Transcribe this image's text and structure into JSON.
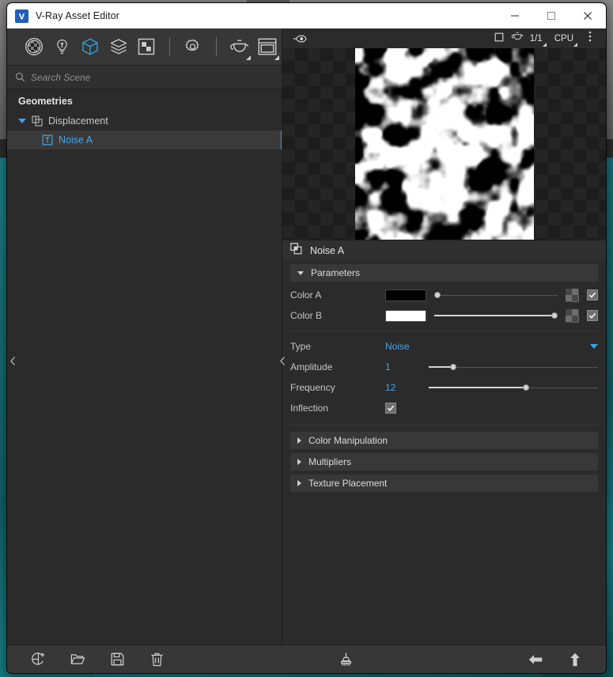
{
  "window": {
    "title": "V-Ray Asset Editor",
    "logo_icon": "vray-logo-icon",
    "minimize_label": "–",
    "maximize_label": "□",
    "close_label": "×"
  },
  "toolbar": {
    "items": [
      {
        "name": "materials-button",
        "icon": "checker-sphere-icon",
        "active": false,
        "dropdown": false
      },
      {
        "name": "lights-button",
        "icon": "light-bulb-icon",
        "active": false,
        "dropdown": false
      },
      {
        "name": "geometries-button",
        "icon": "cube-icon",
        "active": true,
        "dropdown": false
      },
      {
        "name": "render-elements-button",
        "icon": "layers-icon",
        "active": false,
        "dropdown": false
      },
      {
        "name": "textures-button",
        "icon": "texture-icon",
        "active": false,
        "dropdown": false
      },
      {
        "name": "settings-button",
        "icon": "gear-icon",
        "active": false,
        "dropdown": false
      },
      {
        "name": "render-button",
        "icon": "teapot-icon",
        "active": false,
        "dropdown": true
      },
      {
        "name": "frame-buffer-button",
        "icon": "render-window-icon",
        "active": false,
        "dropdown": true
      }
    ]
  },
  "search": {
    "icon": "search-icon",
    "placeholder": "Search Scene",
    "value": ""
  },
  "tree": {
    "category": "Geometries",
    "nodes": [
      {
        "label": "Displacement",
        "icon": "displacement-icon",
        "level": 1,
        "expanded": true,
        "selected": false
      },
      {
        "label": "Noise A",
        "icon": "noise-texture-icon",
        "level": 2,
        "expanded": false,
        "selected": true
      }
    ]
  },
  "preview_header": {
    "left_icon": "visibility-toggle-icon",
    "buttons": [
      {
        "name": "preview-shape-button",
        "icon": "square-icon",
        "dropdown": false
      },
      {
        "name": "preview-teapot-button",
        "icon": "teapot-icon",
        "dropdown": false
      }
    ],
    "quality": "1/1",
    "engine": "CPU",
    "more_icon": "more-vertical-icon"
  },
  "preview": {
    "name": "texture-preview",
    "description": "black and white noise texture on transparency checkerboard"
  },
  "asset": {
    "icon": "texture-icon",
    "name": "Noise A"
  },
  "parameters": {
    "section_label": "Parameters",
    "expanded": true,
    "rows": {
      "color_a": {
        "label": "Color A",
        "swatch_color": "#000000",
        "slider_pct": 0,
        "map_icon": "checker-map-icon",
        "enabled": true
      },
      "color_b": {
        "label": "Color B",
        "swatch_color": "#ffffff",
        "slider_pct": 100,
        "map_icon": "checker-map-icon",
        "enabled": true
      },
      "type": {
        "label": "Type",
        "value": "Noise",
        "caret_icon": "chevron-down-icon"
      },
      "amplitude": {
        "label": "Amplitude",
        "value": "1",
        "slider_pct": 13
      },
      "frequency": {
        "label": "Frequency",
        "value": "12",
        "slider_pct": 58
      },
      "inflection": {
        "label": "Inflection",
        "checked": true
      }
    }
  },
  "sections": [
    {
      "label": "Color Manipulation",
      "expanded": false,
      "name": "section-color-manipulation"
    },
    {
      "label": "Multipliers",
      "expanded": false,
      "name": "section-multipliers"
    },
    {
      "label": "Texture Placement",
      "expanded": false,
      "name": "section-texture-placement"
    }
  ],
  "bottom_bar": {
    "left": [
      {
        "name": "add-asset-button",
        "icon": "add-asset-icon"
      },
      {
        "name": "open-asset-button",
        "icon": "folder-open-icon"
      },
      {
        "name": "save-asset-button",
        "icon": "floppy-save-icon"
      },
      {
        "name": "delete-asset-button",
        "icon": "trash-icon"
      }
    ],
    "center": [
      {
        "name": "purge-button",
        "icon": "broom-purge-icon"
      }
    ],
    "right": [
      {
        "name": "back-button",
        "icon": "arrow-left-icon"
      },
      {
        "name": "up-button",
        "icon": "arrow-up-icon"
      }
    ]
  },
  "panel_collapse": {
    "left_chevron": "chevron-left-icon",
    "mid_chevron": "chevron-left-icon"
  },
  "colors": {
    "accent_blue": "#3f9fe0",
    "panel_bg": "#2b2b2b",
    "toolbar_bg": "#373737",
    "section_bg": "#383838",
    "titlebar_bg": "#ffffff",
    "backdrop_teal": "#19787f"
  }
}
